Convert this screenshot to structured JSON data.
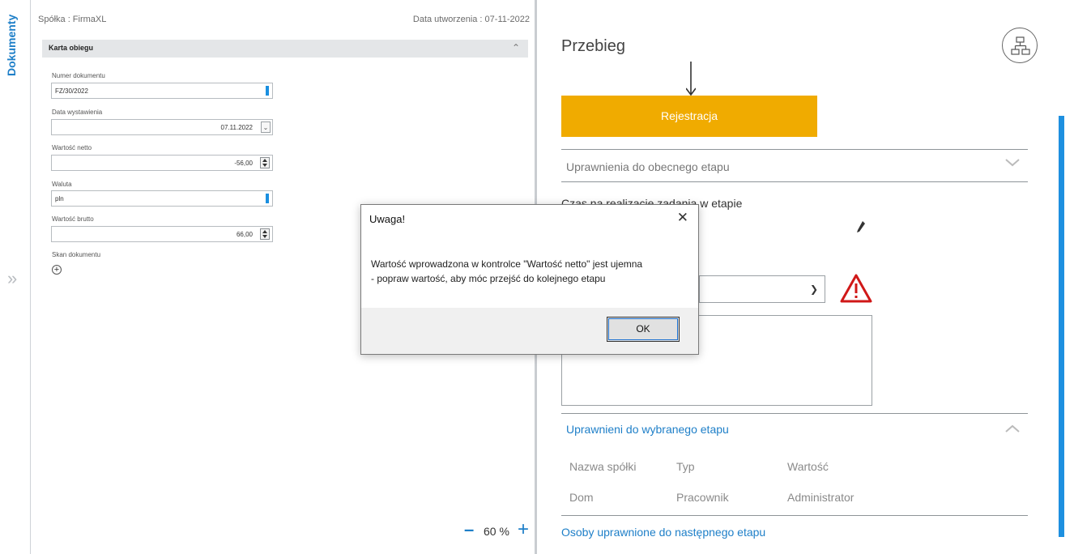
{
  "rail": {
    "tab_label": "Dokumenty",
    "expand_icon": "double-chevron-right-icon"
  },
  "form": {
    "company": "Spółka : FirmaXL",
    "created": "Data utworzenia : 07-11-2022",
    "section_title": "Karta obiegu",
    "fields": [
      {
        "label": "Numer dokumentu",
        "value": "FZ/30/2022"
      },
      {
        "label": "Data wystawienia",
        "value": "07.11.2022"
      },
      {
        "label": "Wartość netto",
        "value": "-56,00"
      },
      {
        "label": "Waluta",
        "value": "pln"
      },
      {
        "label": "Wartość brutto",
        "value": "66,00"
      }
    ],
    "scan_label": "Skan dokumentu",
    "zoom": "60 %"
  },
  "workflow": {
    "title": "Przebieg",
    "stage": "Rejestracja",
    "perm_current": "Uprawnienia do obecnego etapu",
    "time_label": "Czas na realizację zadania w etapie",
    "perm_chosen": "Uprawnieni do wybranego etapu",
    "table_headers": [
      "Nazwa spółki",
      "Typ",
      "Wartość"
    ],
    "table_row": [
      "Dom",
      "Pracownik",
      "Administrator"
    ],
    "next_link": "Osoby uprawnione do następnego etapu",
    "stage_color": "#f0ab00",
    "accent": "#1e7fc8"
  },
  "dialog": {
    "title": "Uwaga!",
    "line1": "Wartość wprowadzona w kontrolce \"Wartość netto\" jest ujemna",
    "line2": "- popraw wartość, aby móc przejść do kolejnego etapu",
    "ok": "OK"
  }
}
